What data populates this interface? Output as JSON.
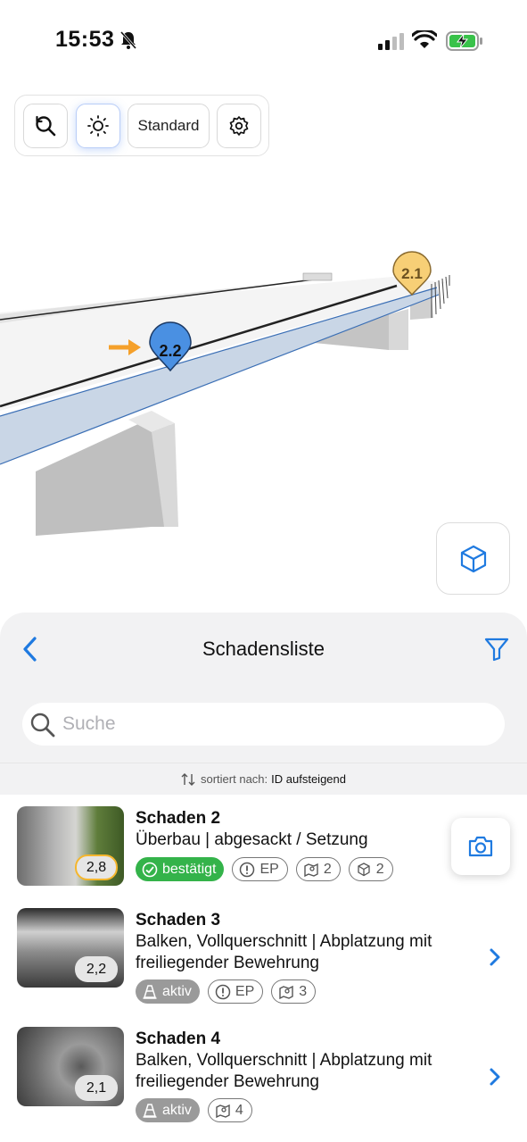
{
  "status": {
    "time": "15:53"
  },
  "toolbar": {
    "reset_icon": "reset-icon",
    "sun_icon": "sun-icon",
    "view_mode": "Standard",
    "settings_icon": "gear-icon"
  },
  "scene": {
    "markers": [
      {
        "label": "2.2",
        "color": "#4a90e2"
      },
      {
        "label": "2.1",
        "color": "#f7cf76"
      }
    ],
    "arrow_color": "#f5a02a"
  },
  "sheet": {
    "title": "Schadensliste",
    "search_placeholder": "Suche",
    "sort_prefix": "sortiert nach:",
    "sort_key": "ID aufsteigend"
  },
  "items": [
    {
      "name": "Schaden 2",
      "description": "Überbau | abgesackt / Setzung",
      "score": "2,8",
      "status": "bestätigt",
      "chips": [
        {
          "icon": "alert-icon",
          "text": "EP"
        },
        {
          "icon": "map-pin-icon",
          "text": "2"
        },
        {
          "icon": "cube-icon",
          "text": "2"
        }
      ]
    },
    {
      "name": "Schaden 3",
      "description": "Balken, Vollquerschnitt | Abplatzung mit freiliegender Bewehrung",
      "score": "2,2",
      "status": "aktiv",
      "chips": [
        {
          "icon": "alert-icon",
          "text": "EP"
        },
        {
          "icon": "map-pin-icon",
          "text": "3"
        }
      ]
    },
    {
      "name": "Schaden 4",
      "description": "Balken, Vollquerschnitt | Abplatzung mit freiliegender Bewehrung",
      "score": "2,1",
      "status": "aktiv",
      "chips": [
        {
          "icon": "map-pin-icon",
          "text": "4"
        }
      ]
    }
  ],
  "colors": {
    "accent": "#1f7ae0",
    "confirmed": "#34b34a",
    "active": "#9a9a9a"
  }
}
